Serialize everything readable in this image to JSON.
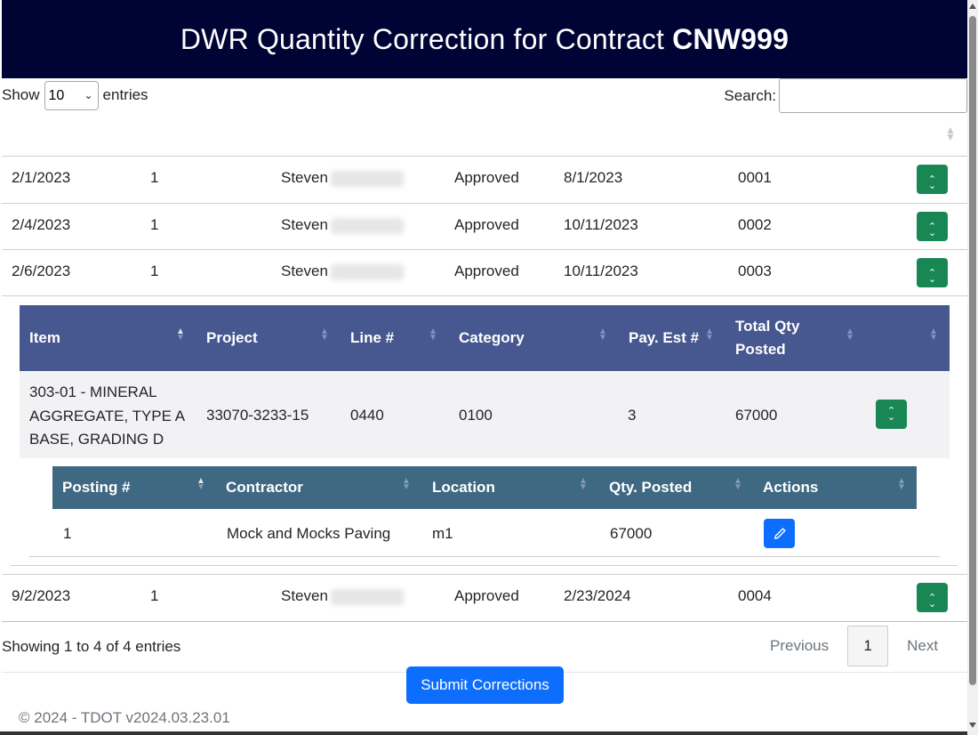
{
  "header": {
    "title_prefix": "DWR Quantity Correction for Contract",
    "contract": "CNW999"
  },
  "length_menu": {
    "label_before": "Show",
    "value": "10",
    "label_after": "entries"
  },
  "search": {
    "label": "Search:",
    "value": ""
  },
  "dwr_rows": [
    {
      "date": "2/1/2023",
      "number": "1",
      "name": "Steven",
      "status": "Approved",
      "date2": "8/1/2023",
      "code": "0001"
    },
    {
      "date": "2/4/2023",
      "number": "1",
      "name": "Steven",
      "status": "Approved",
      "date2": "10/11/2023",
      "code": "0002"
    },
    {
      "date": "2/6/2023",
      "number": "1",
      "name": "Steven",
      "status": "Approved",
      "date2": "10/11/2023",
      "code": "0003"
    },
    {
      "date": "9/2/2023",
      "number": "1",
      "name": "Steven",
      "status": "Approved",
      "date2": "2/23/2024",
      "code": "0004"
    }
  ],
  "item_table": {
    "headers": {
      "item": "Item",
      "project": "Project",
      "line": "Line #",
      "category": "Category",
      "pay_est": "Pay. Est #",
      "total_qty_1": "Total Qty",
      "total_qty_2": "Posted"
    },
    "row": {
      "item_1": "303-01 - MINERAL",
      "item_2": "AGGREGATE, TYPE A",
      "item_3": "BASE, GRADING D",
      "project": "33070-3233-15",
      "line": "0440",
      "category": "0100",
      "pay_est": "3",
      "total_qty": "67000"
    }
  },
  "posting_table": {
    "headers": {
      "posting": "Posting #",
      "contractor": "Contractor",
      "location": "Location",
      "qty": "Qty. Posted",
      "actions": "Actions"
    },
    "row": {
      "posting": "1",
      "contractor": "Mock and Mocks Paving",
      "location": "m1",
      "qty": "67000"
    }
  },
  "footer": {
    "info": "Showing 1 to 4 of 4 entries",
    "previous": "Previous",
    "page": "1",
    "next": "Next",
    "submit": "Submit Corrections",
    "copyright": "© 2024 - TDOT v2024.03.23.01"
  },
  "colors": {
    "header_bg": "#000435",
    "success": "#198754",
    "primary": "#0d6efd",
    "item_header": "#47578f",
    "posting_header": "#3f6883"
  }
}
